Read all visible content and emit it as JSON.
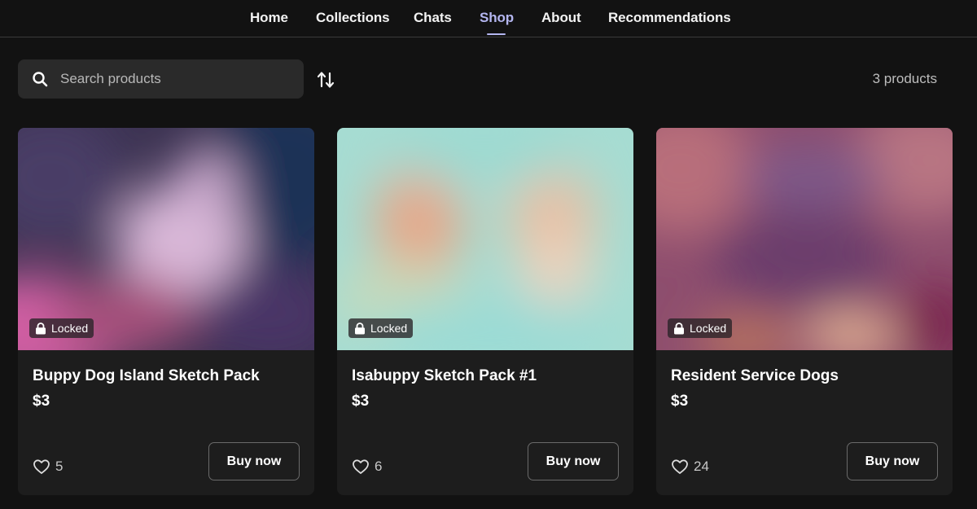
{
  "nav": {
    "items": [
      {
        "label": "Home",
        "active": false
      },
      {
        "label": "Collections",
        "active": false
      },
      {
        "label": "Chats",
        "active": false
      },
      {
        "label": "Shop",
        "active": true
      },
      {
        "label": "About",
        "active": false
      },
      {
        "label": "Recommendations",
        "active": false
      }
    ],
    "active_color": "#b4b6f0"
  },
  "toolbar": {
    "search_placeholder": "Search products",
    "search_value": "",
    "search_icon": "search-icon",
    "sort_icon": "sort-arrows-icon",
    "product_count": "3 products"
  },
  "products": [
    {
      "title": "Buppy Dog Island Sketch Pack",
      "price": "$3",
      "badge": "Locked",
      "likes": "5",
      "buy_label": "Buy now",
      "palette": [
        "#1d2a4a",
        "#d8b4d6",
        "#c85a9c",
        "#3a2a5a"
      ]
    },
    {
      "title": "Isabuppy Sketch Pack #1",
      "price": "$3",
      "badge": "Locked",
      "likes": "6",
      "buy_label": "Buy now",
      "palette": [
        "#9edcd4",
        "#e3a98c",
        "#e9c4ad",
        "#bde0d6"
      ]
    },
    {
      "title": "Resident Service Dogs",
      "price": "$3",
      "badge": "Locked",
      "likes": "24",
      "buy_label": "Buy now",
      "palette": [
        "#b86c78",
        "#6e3f6e",
        "#d9a98e",
        "#7a2a52"
      ]
    }
  ],
  "colors": {
    "background": "#121212",
    "card": "#1d1d1d",
    "search_bg": "#2a2a2a"
  }
}
